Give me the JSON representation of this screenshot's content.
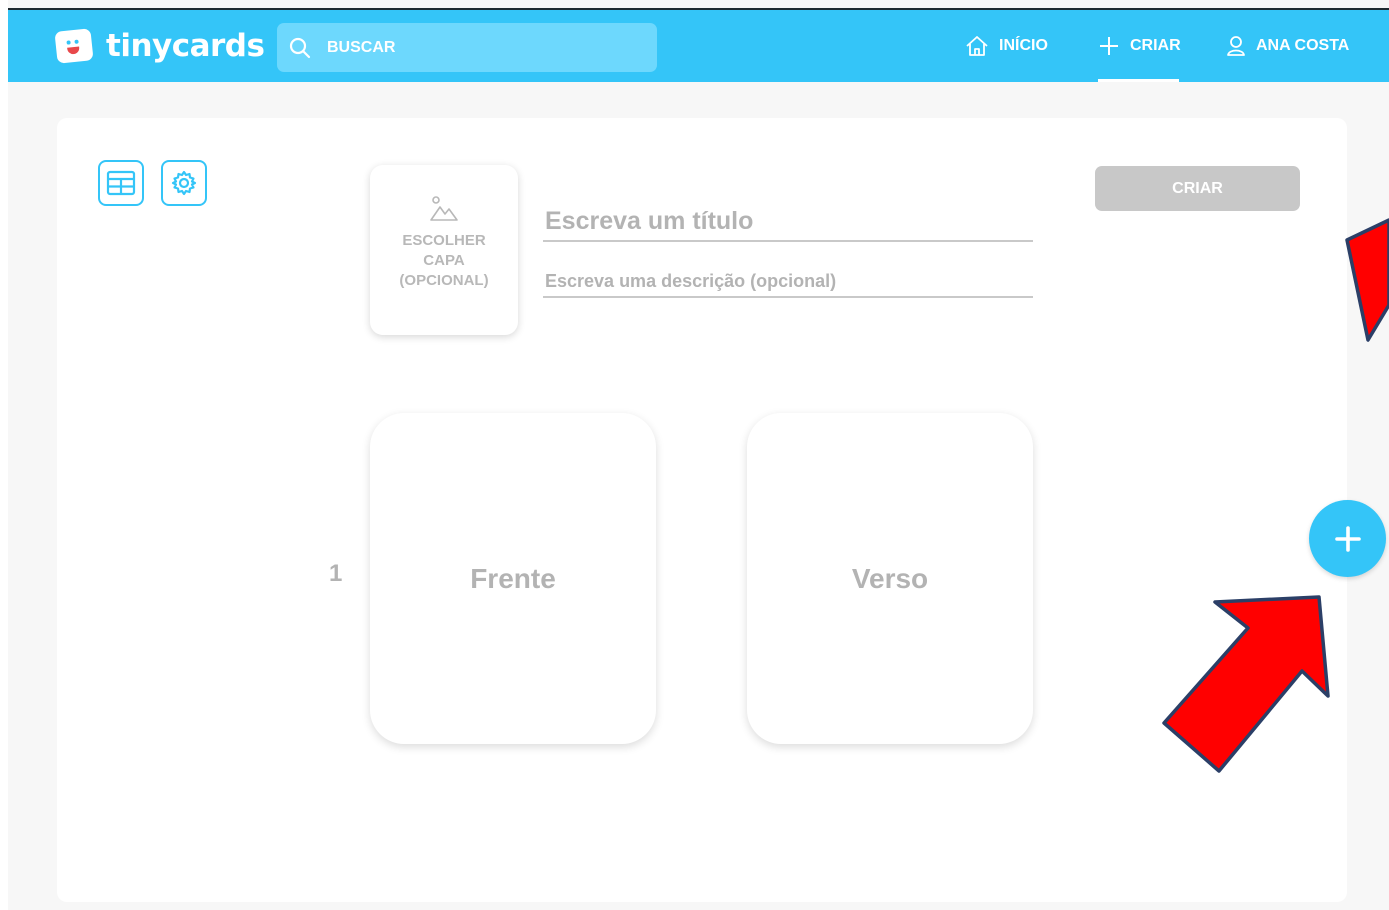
{
  "header": {
    "logo_text": "tinycards",
    "search_placeholder": "BUSCAR",
    "nav": {
      "home": "INÍCIO",
      "create": "CRIAR",
      "user": "ANA COSTA"
    }
  },
  "editor": {
    "cover_label": "ESCOLHER CAPA (OPCIONAL)",
    "title_placeholder": "Escreva um título",
    "description_placeholder": "Escreva uma descrição (opcional)",
    "create_button": "CRIAR",
    "cards": [
      {
        "number": "1",
        "front": "Frente",
        "back": "Verso"
      }
    ]
  },
  "colors": {
    "accent": "#34c5f8",
    "annotation_arrow": "#ff0000"
  },
  "icons": [
    "search-icon",
    "home-icon",
    "plus-icon",
    "user-icon",
    "grid-icon",
    "gear-icon",
    "image-icon",
    "add-card-icon"
  ]
}
